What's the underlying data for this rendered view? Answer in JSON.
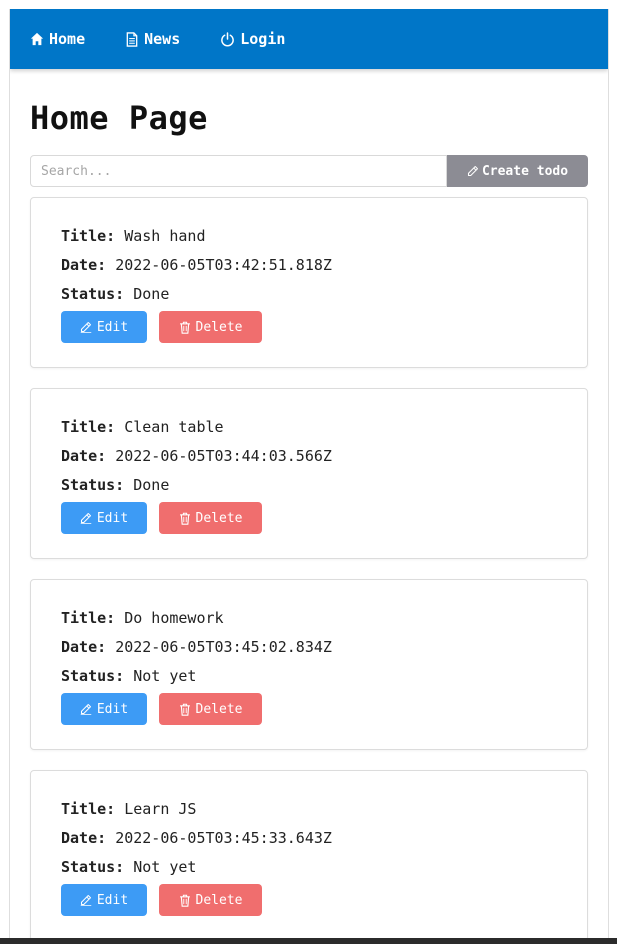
{
  "nav": {
    "items": [
      {
        "label": "Home",
        "icon": "home-icon"
      },
      {
        "label": "News",
        "icon": "document-icon"
      },
      {
        "label": "Login",
        "icon": "power-icon"
      }
    ]
  },
  "page": {
    "title": "Home Page"
  },
  "search": {
    "placeholder": "Search...",
    "value": ""
  },
  "toolbar": {
    "create_label": "Create todo"
  },
  "labels": {
    "title": "Title:",
    "date": "Date:",
    "status": "Status:",
    "edit": "Edit",
    "delete": "Delete"
  },
  "todos": [
    {
      "title": "Wash hand",
      "date": "2022-06-05T03:42:51.818Z",
      "status": "Done"
    },
    {
      "title": "Clean table",
      "date": "2022-06-05T03:44:03.566Z",
      "status": "Done"
    },
    {
      "title": "Do homework",
      "date": "2022-06-05T03:45:02.834Z",
      "status": "Not yet"
    },
    {
      "title": "Learn JS",
      "date": "2022-06-05T03:45:33.643Z",
      "status": "Not yet"
    }
  ],
  "colors": {
    "navbar": "#0076c8",
    "create_button": "#8c8c94",
    "edit_button": "#3d9bf5",
    "delete_button": "#f06e6e"
  }
}
